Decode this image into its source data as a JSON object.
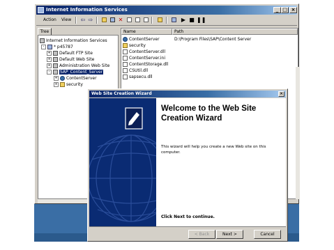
{
  "main_window": {
    "title": "Internet Information Services",
    "menu": {
      "action": "Action",
      "view": "View"
    },
    "toolbar_icons": [
      "back-icon",
      "forward-icon",
      "up-folder-icon",
      "show-tree-icon",
      "delete-icon",
      "properties-icon",
      "refresh-icon",
      "export-icon",
      "help-icon",
      "computer-icon",
      "start-icon",
      "stop-icon",
      "pause-icon"
    ],
    "tree_tab": "Tree",
    "tree": [
      {
        "label": "Internet Information Services",
        "indent": 0,
        "icon": "iis-icon",
        "expander": ""
      },
      {
        "label": "* p45787",
        "indent": 1,
        "icon": "computer-icon",
        "expander": "-"
      },
      {
        "label": "Default FTP Site",
        "indent": 2,
        "icon": "site-icon",
        "expander": "+"
      },
      {
        "label": "Default Web Site",
        "indent": 2,
        "icon": "site-icon",
        "expander": "+"
      },
      {
        "label": "Administration Web Site",
        "indent": 2,
        "icon": "site-icon",
        "expander": "+"
      },
      {
        "label": "SAP_Content_Server",
        "indent": 2,
        "icon": "site-icon",
        "expander": "-",
        "selected": true
      },
      {
        "label": "ContentServer",
        "indent": 3,
        "icon": "globe-icon",
        "expander": "+"
      },
      {
        "label": "security",
        "indent": 3,
        "icon": "folder-icon",
        "expander": "+"
      }
    ],
    "list_columns": [
      "Name",
      "Path"
    ],
    "list": [
      {
        "name": "ContentServer",
        "path": "D:\\Program Files\\SAP\\Content Server",
        "icon": "globe-icon"
      },
      {
        "name": "security",
        "path": "",
        "icon": "folder-icon"
      },
      {
        "name": "ContentServer.dll",
        "path": "",
        "icon": "file-icon"
      },
      {
        "name": "ContentServer.ini",
        "path": "",
        "icon": "file-icon"
      },
      {
        "name": "ContentStorage.dll",
        "path": "",
        "icon": "file-icon"
      },
      {
        "name": "CSUtil.dll",
        "path": "",
        "icon": "file-icon"
      },
      {
        "name": "sapsecu.dll",
        "path": "",
        "icon": "file-icon"
      }
    ]
  },
  "wizard": {
    "title": "Web Site Creation Wizard",
    "heading": "Welcome to the Web Site Creation Wizard",
    "description": "This wizard will help you create a new Web site on this computer.",
    "continue_text": "Click Next to continue.",
    "buttons": {
      "back": "< Back",
      "next": "Next >",
      "cancel": "Cancel"
    }
  },
  "colors": {
    "title_blue": "#0a246a",
    "face": "#d4d0c8",
    "wizard_panel": "#0a2b73",
    "desktop": "#3a6ea5"
  }
}
